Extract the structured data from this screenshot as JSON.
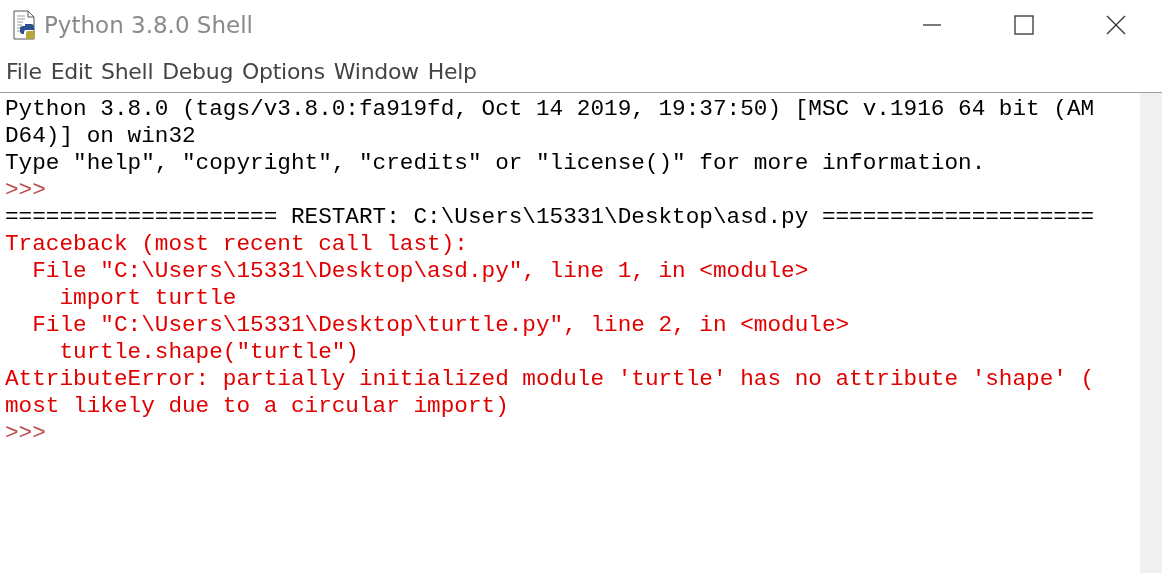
{
  "window": {
    "title": "Python 3.8.0 Shell"
  },
  "menu": [
    {
      "label": "File"
    },
    {
      "label": "Edit"
    },
    {
      "label": "Shell"
    },
    {
      "label": "Debug"
    },
    {
      "label": "Options"
    },
    {
      "label": "Window"
    },
    {
      "label": "Help"
    }
  ],
  "shell_lines": [
    {
      "kind": "output",
      "text": "Python 3.8.0 (tags/v3.8.0:fa919fd, Oct 14 2019, 19:37:50) [MSC v.1916 64 bit (AM"
    },
    {
      "kind": "output",
      "text": "D64)] on win32"
    },
    {
      "kind": "output",
      "text": "Type \"help\", \"copyright\", \"credits\" or \"license()\" for more information."
    },
    {
      "kind": "prompt",
      "text": ">>>"
    },
    {
      "kind": "output",
      "text": "==================== RESTART: C:\\Users\\15331\\Desktop\\asd.py ===================="
    },
    {
      "kind": "error",
      "text": "Traceback (most recent call last):"
    },
    {
      "kind": "error",
      "text": "  File \"C:\\Users\\15331\\Desktop\\asd.py\", line 1, in <module>"
    },
    {
      "kind": "error",
      "text": "    import turtle"
    },
    {
      "kind": "error",
      "text": "  File \"C:\\Users\\15331\\Desktop\\turtle.py\", line 2, in <module>"
    },
    {
      "kind": "error",
      "text": "    turtle.shape(\"turtle\")"
    },
    {
      "kind": "error",
      "text": "AttributeError: partially initialized module 'turtle' has no attribute 'shape' ("
    },
    {
      "kind": "error",
      "text": "most likely due to a circular import)"
    },
    {
      "kind": "prompt",
      "text": ">>>"
    }
  ]
}
